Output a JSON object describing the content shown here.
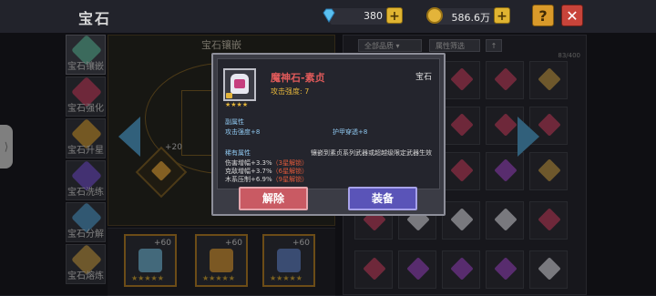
{
  "header": {
    "title": "宝石",
    "gems_amount": "380",
    "gold_amount": "586.6万",
    "help_label": "?",
    "close_label": "✕",
    "plus_label": "+"
  },
  "sidenav": [
    {
      "label": "宝石镶嵌",
      "color": "#6cc2a8"
    },
    {
      "label": "宝石强化",
      "color": "#c84a6a"
    },
    {
      "label": "宝石升星",
      "color": "#d4a040"
    },
    {
      "label": "宝石洗练",
      "color": "#7a5ad0"
    },
    {
      "label": "宝石分解",
      "color": "#5aa0d0"
    },
    {
      "label": "宝石熔炼",
      "color": "#c8a050"
    }
  ],
  "socket_panel": {
    "title": "宝石镶嵌",
    "level_label": "+20"
  },
  "equip_slots": [
    {
      "level": "+60",
      "stars": "★★★★★",
      "color": "#7ac0e0"
    },
    {
      "level": "+60",
      "stars": "★★★★★",
      "color": "#e0a040"
    },
    {
      "level": "+60",
      "stars": "★★★★★",
      "color": "#6a8ad0"
    }
  ],
  "inventory": {
    "filter_all": "全部品质",
    "filter_attr": "属性筛选",
    "sort_label": "↑",
    "capacity": "83/400"
  },
  "popup": {
    "gem_name": "魔神石-素贞",
    "gem_type": "宝石",
    "main_stat": "攻击强度: 7",
    "sub_title": "副属性",
    "sub_stat_1": "攻击强度+8",
    "sub_stat_2": "护甲穿透+8",
    "rare_title": "稀有属性",
    "note": "镶嵌到素贞系列武器或超越级限定武器生效",
    "rare_1_text": "伤害增幅+3.3%",
    "rare_1_tag": "（3星解锁）",
    "rare_2_text": "克敌增幅+3.7%",
    "rare_2_tag": "（6星解锁）",
    "rare_3_text": "木系压制+6.9%",
    "rare_3_tag": "（9星解锁）",
    "stars": "★★★★",
    "remove_label": "解除",
    "equip_label": "装备"
  },
  "colors": {
    "accent_blue": "#5ab0e0",
    "remove_red": "#c95a63",
    "equip_purple": "#5a54b8",
    "gold": "#e3b43a"
  }
}
